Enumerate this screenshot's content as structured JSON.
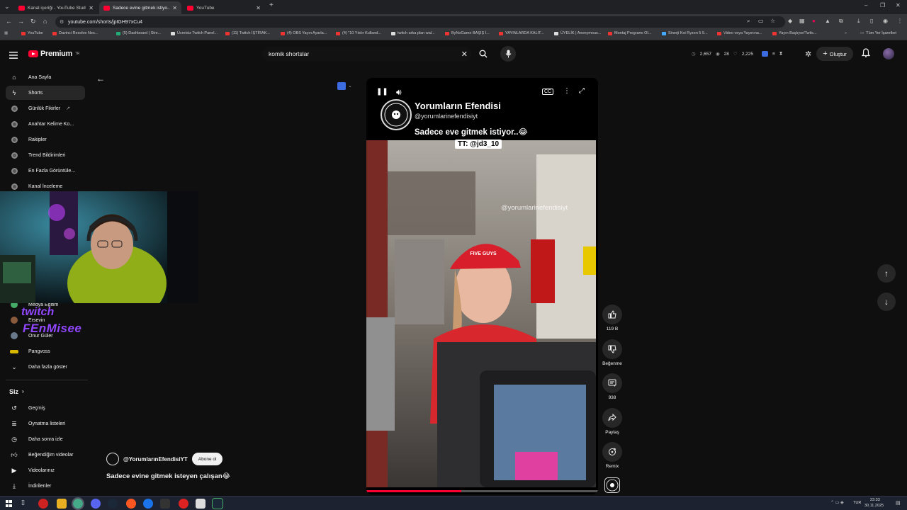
{
  "browser": {
    "tabs": [
      {
        "title": "Kanal içeriği - YouTube Studio"
      },
      {
        "title": "Sadece evine gitmek istiyo..."
      },
      {
        "title": "YouTube"
      }
    ],
    "url": "youtube.com/shorts/jpIGH97xCu4",
    "bookmarks": [
      "YouTube",
      "Davinci Resolve Nes...",
      "(5) Dashboard | Stre...",
      "Ücretsiz Twitch Panel...",
      "(11) Twitch İŞTİRAK...",
      "(4) OBS Yayın Ayarla...",
      "(4) \"10 Yıldır Kulland...",
      "twitch arka plan wal...",
      "ByNoGame BAŞIŞ İ...",
      "YAYINLARDA KALIT...",
      "ÜYELİK | Anonymous...",
      "Montaj Programı Ol...",
      "Sinerji Koi Ryzen 5 5...",
      "Video veya Yayınına...",
      "Yayın Başlıyor/Twitc...",
      "Tüm Yer İşaretleri"
    ]
  },
  "header": {
    "logo": "Premium",
    "logo_region": "TR",
    "search_value": "komik shortslar",
    "stats": {
      "views": "2,657",
      "viewers": "28",
      "followers": "2,225"
    },
    "create_label": "Oluştur"
  },
  "sidebar": {
    "top_items": [
      {
        "label": "Ana Sayfa"
      },
      {
        "label": "Shorts"
      },
      {
        "label": "Günlük Fikirler"
      },
      {
        "label": "Anahtar Kelime Ko..."
      },
      {
        "label": "Rakipler"
      },
      {
        "label": "Trend Bildirimleri"
      },
      {
        "label": "En Fazla Görüntüle..."
      },
      {
        "label": "Kanal İnceleme"
      }
    ],
    "subs": [
      {
        "label": "Medya Eğitim"
      },
      {
        "label": "Ersevin"
      },
      {
        "label": "Onur Güler"
      },
      {
        "label": "Pangvoss"
      },
      {
        "label": "Daha fazla göster"
      }
    ],
    "siz_label": "Siz",
    "you_items": [
      {
        "label": "Geçmiş"
      },
      {
        "label": "Oynatma listeleri"
      },
      {
        "label": "Daha sonra izle"
      },
      {
        "label": "Beğendiğim videolar"
      },
      {
        "label": "Videolarınız"
      },
      {
        "label": "İndirilenler"
      }
    ]
  },
  "webcam_overlay": {
    "twitch": "twitch",
    "handle": "FEnMisee"
  },
  "short": {
    "channel_name": "Yorumların Efendisi",
    "channel_handle": "@yorumlarinefendisiyt",
    "caption": "Sadece eve gitmek istiyor..😂",
    "credit": "TT: @jd3_10",
    "watermark": "@yorumlarinefendisiyt",
    "hat_text": "FIVE GUYS"
  },
  "actions": {
    "likes": "119 B",
    "dislike_label": "Beğenme",
    "comments": "938",
    "share_label": "Paylaş",
    "remix_label": "Remix"
  },
  "meta": {
    "channel": "@YorumlarınEfendisiYT",
    "subscribe_label": "Abone ol",
    "title": "Sadece evine gitmek isteyen çalışan😂"
  },
  "taskbar": {
    "lang": "TUR",
    "time": "23:33",
    "date": "30.11.2025"
  },
  "colors": {
    "brand": "#ff0033",
    "bg": "#0f0f0f",
    "surface": "#272727"
  }
}
